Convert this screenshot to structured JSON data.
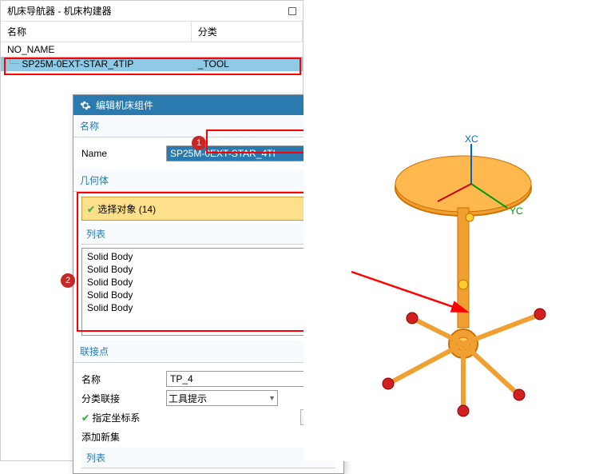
{
  "navigator": {
    "title": "机床导航器 - 机床构建器",
    "columns": {
      "name": "名称",
      "category": "分类"
    },
    "rows": [
      {
        "name": "NO_NAME",
        "category": ""
      },
      {
        "name": "SP25M-0EXT-STAR_4TIP",
        "category": "_TOOL"
      }
    ]
  },
  "dialog": {
    "title": "编辑机床组件",
    "sections": {
      "name": {
        "header": "名称",
        "label": "Name",
        "value": "SP25M-0EXT-STAR_4TI"
      },
      "geometry": {
        "header": "几何体",
        "select_label": "选择对象 (14)",
        "list_header": "列表",
        "items": [
          "Solid Body",
          "Solid Body",
          "Solid Body",
          "Solid Body",
          "Solid Body"
        ]
      },
      "junction": {
        "header": "联接点",
        "name_label": "名称",
        "name_value": "TP_4",
        "classify_label": "分类联接",
        "classify_value": "工具提示",
        "csys_label": "指定坐标系",
        "addnew_label": "添加新集",
        "list_header": "列表"
      }
    }
  },
  "callouts": {
    "one": "1",
    "two": "2"
  },
  "axes": {
    "x": "XC",
    "y": "YC"
  }
}
